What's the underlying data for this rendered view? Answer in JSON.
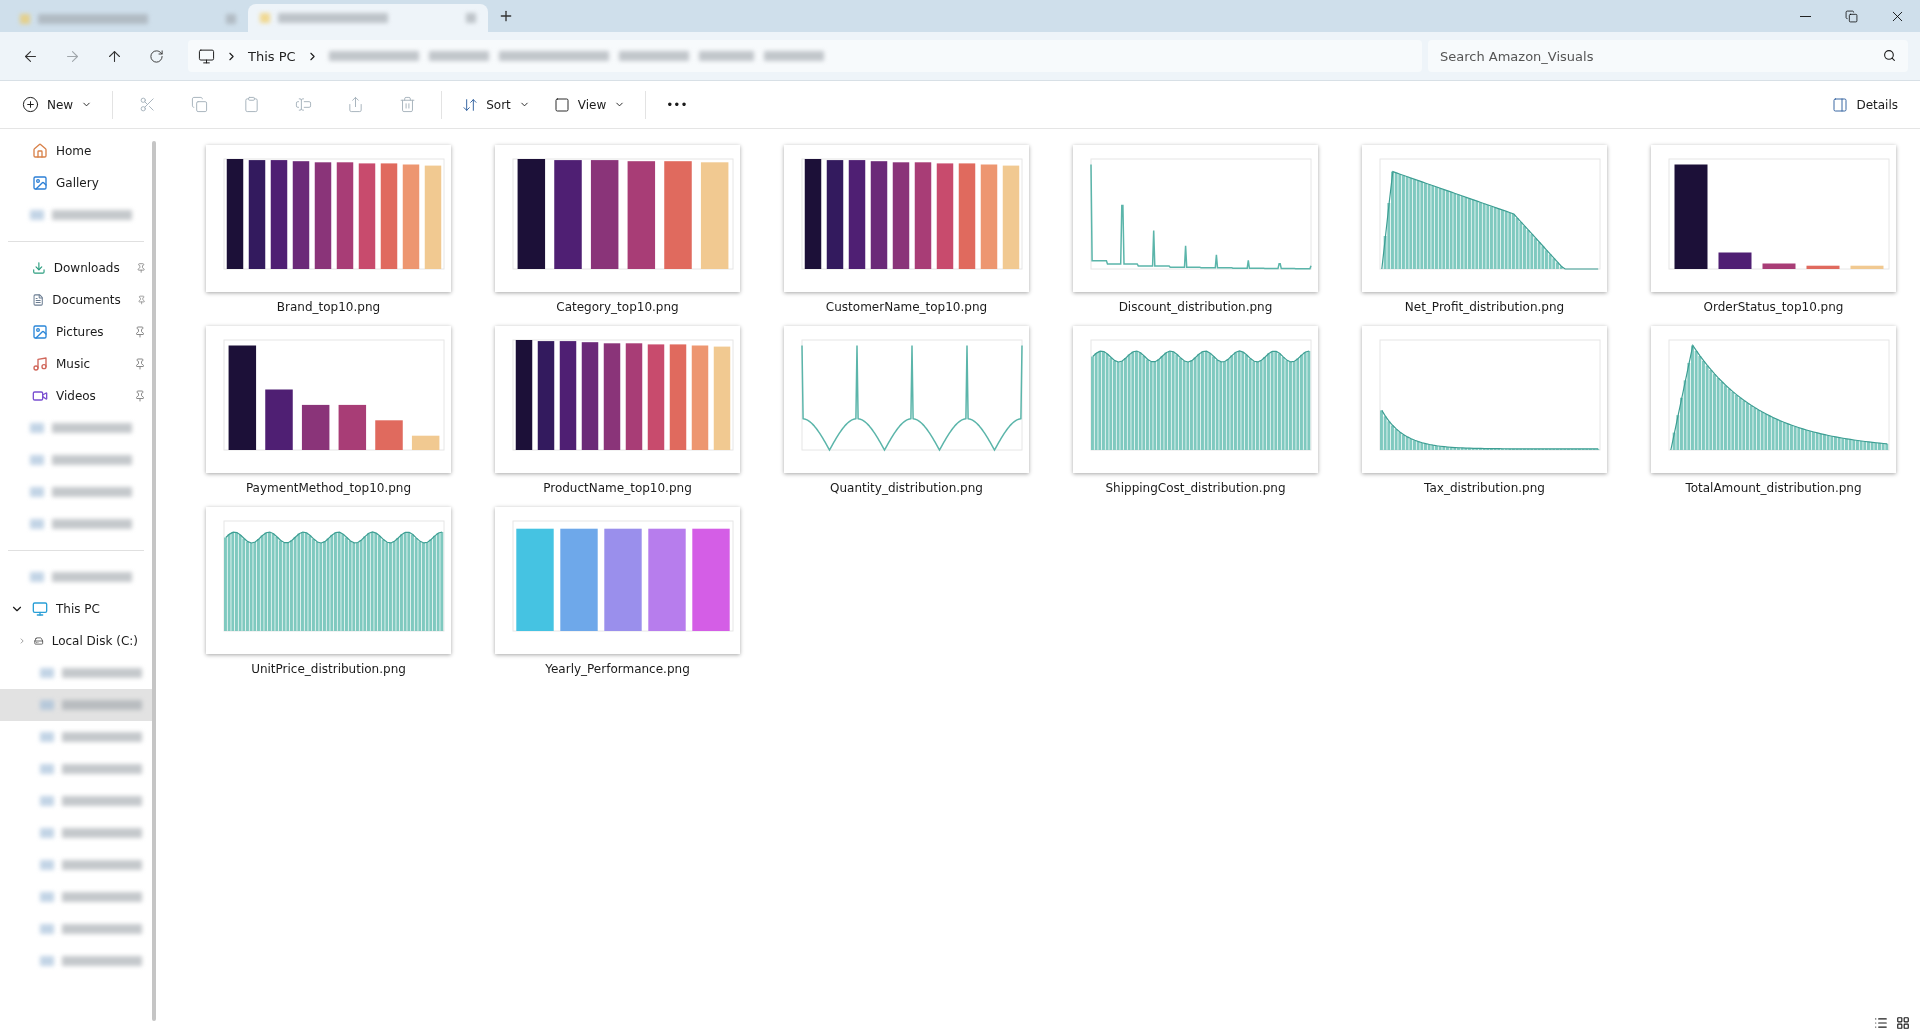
{
  "tabs": [
    {
      "selected": false
    },
    {
      "selected": true
    }
  ],
  "address": {
    "crumbs": [
      "This PC"
    ]
  },
  "search": {
    "placeholder": "Search Amazon_Visuals"
  },
  "toolbar": {
    "new": "New",
    "sort": "Sort",
    "view": "View",
    "more": "•••",
    "details": "Details",
    "actions": [
      {
        "kind": "cut",
        "disabled": true
      },
      {
        "kind": "copy",
        "disabled": true
      },
      {
        "kind": "paste",
        "disabled": true
      },
      {
        "kind": "rename",
        "disabled": true
      },
      {
        "kind": "share",
        "disabled": true
      },
      {
        "kind": "delete",
        "disabled": true
      }
    ]
  },
  "sidebar": {
    "sections": [
      [
        {
          "kind": "home",
          "label": "Home"
        },
        {
          "kind": "gallery",
          "label": "Gallery"
        },
        {
          "kind": "redacted",
          "selected": false
        }
      ],
      [
        {
          "kind": "downloads",
          "label": "Downloads",
          "pinned": true
        },
        {
          "kind": "documents",
          "label": "Documents",
          "pinned": true
        },
        {
          "kind": "pictures",
          "label": "Pictures",
          "pinned": true
        },
        {
          "kind": "music",
          "label": "Music",
          "pinned": true
        },
        {
          "kind": "videos",
          "label": "Videos",
          "pinned": true
        },
        {
          "kind": "redacted",
          "selected": false
        },
        {
          "kind": "redacted",
          "selected": false
        },
        {
          "kind": "redacted",
          "selected": false
        },
        {
          "kind": "redacted",
          "selected": false
        }
      ],
      [
        {
          "kind": "redacted",
          "selected": false
        },
        {
          "kind": "pc",
          "label": "This PC",
          "expanded": true,
          "children": [
            {
              "kind": "disk",
              "label": "Local Disk (C:)",
              "expanded": false
            },
            {
              "kind": "redacted",
              "selected": false
            },
            {
              "kind": "redacted",
              "selected": true
            },
            {
              "kind": "redacted",
              "selected": false
            },
            {
              "kind": "redacted",
              "selected": false
            },
            {
              "kind": "redacted",
              "selected": false
            },
            {
              "kind": "redacted",
              "selected": false
            },
            {
              "kind": "redacted",
              "selected": false
            },
            {
              "kind": "redacted",
              "selected": false
            },
            {
              "kind": "redacted",
              "selected": false
            },
            {
              "kind": "redacted",
              "selected": false
            }
          ]
        }
      ]
    ]
  },
  "files": [
    {
      "name": "Brand_top10.png",
      "kind": "bars-flat"
    },
    {
      "name": "Category_top10.png",
      "kind": "bars-flat6"
    },
    {
      "name": "CustomerName_top10.png",
      "kind": "bars-flat"
    },
    {
      "name": "Discount_distribution.png",
      "kind": "spikes-falling"
    },
    {
      "name": "Net_Profit_distribution.png",
      "kind": "hist-falling"
    },
    {
      "name": "OrderStatus_top10.png",
      "kind": "bars-steep"
    },
    {
      "name": "PaymentMethod_top10.png",
      "kind": "bars-falling"
    },
    {
      "name": "ProductName_top10.png",
      "kind": "bars-flat"
    },
    {
      "name": "Quantity_distribution.png",
      "kind": "spikes-even"
    },
    {
      "name": "ShippingCost_distribution.png",
      "kind": "hist-flat"
    },
    {
      "name": "Tax_distribution.png",
      "kind": "hist-decay"
    },
    {
      "name": "TotalAmount_distribution.png",
      "kind": "hist-skewed"
    },
    {
      "name": "UnitPrice_distribution.png",
      "kind": "hist-flat"
    },
    {
      "name": "Yearly_Performance.png",
      "kind": "bars-bright"
    }
  ]
}
